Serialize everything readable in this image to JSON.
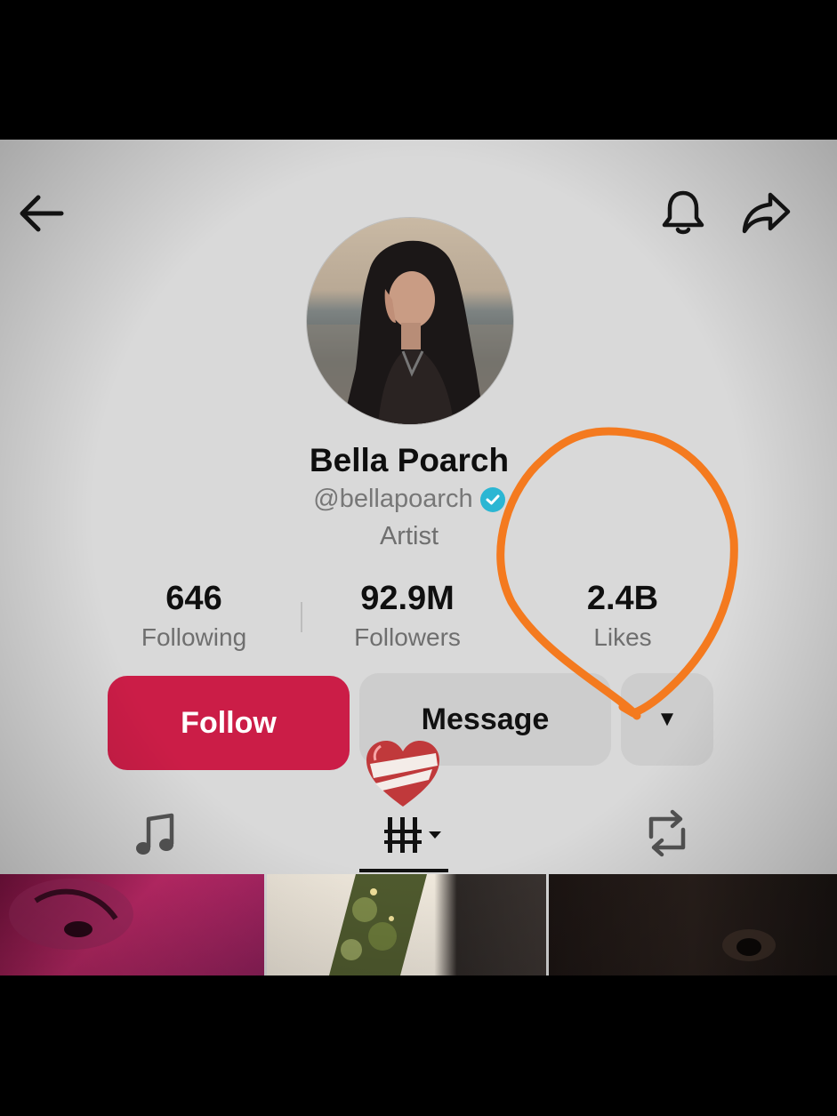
{
  "profile": {
    "name": "Bella Poarch",
    "handle": "@bellapoarch",
    "category": "Artist",
    "verified": true
  },
  "stats": {
    "following": {
      "value": "646",
      "label": "Following"
    },
    "followers": {
      "value": "92.9M",
      "label": "Followers"
    },
    "likes": {
      "value": "2.4B",
      "label": "Likes"
    }
  },
  "actions": {
    "follow_label": "Follow",
    "message_label": "Message",
    "more_symbol": "▼"
  },
  "icons": {
    "back": "arrow-left-icon",
    "bell": "bell-icon",
    "share": "share-arrow-icon",
    "verified": "verified-check-icon",
    "tab_music": "music-note-icon",
    "tab_videos": "grid-bars-icon",
    "tab_reposts": "repost-icon",
    "sticker": "bandaged-heart-icon"
  },
  "colors": {
    "follow_button": "#cb1d47",
    "verified_badge": "#2bb6d3",
    "annotation": "#f47a1f",
    "background": "#d9d9d9"
  }
}
